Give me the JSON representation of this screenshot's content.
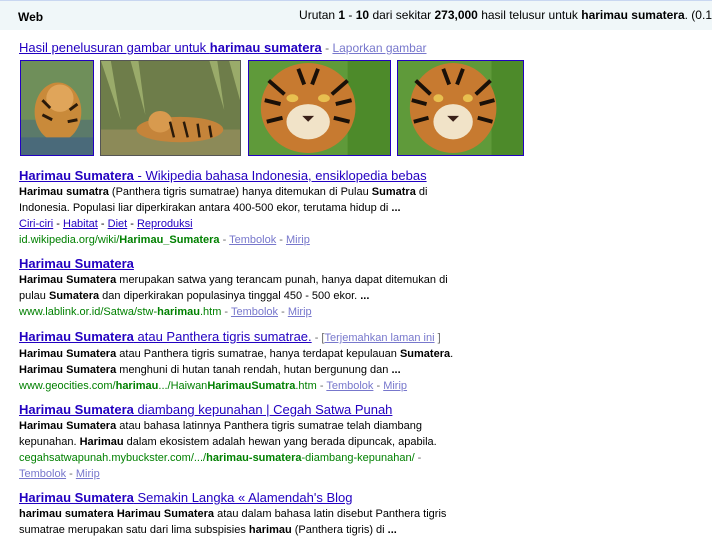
{
  "header": {
    "tab": "Web",
    "stats": {
      "prefix": "Urutan ",
      "from": "1",
      "dash": " - ",
      "to": "10",
      "mid": " dari sekitar ",
      "count": "273,000",
      "mid2": " hasil telusur untuk ",
      "query": "harimau sumatera",
      "suffix": ". (0.1"
    }
  },
  "images": {
    "link_prefix": "Hasil penelusuran gambar untuk ",
    "link_query": "harimau sumatera",
    "separator": " - ",
    "report": "Laporkan gambar",
    "thumbs": [
      {
        "icon": "tiger-in-water-image"
      },
      {
        "icon": "tiger-lying-image"
      },
      {
        "icon": "tiger-face-image"
      },
      {
        "icon": "tiger-face-image"
      }
    ]
  },
  "results": [
    {
      "title_a": "Harimau Sumatera",
      "title_b": " - Wikipedia bahasa Indonesia, ensiklopedia bebas",
      "snip_1a": "Harimau sumatra",
      "snip_1b": " (Panthera tigris sumatrae) hanya ditemukan di Pulau ",
      "snip_1c": "Sumatra",
      "snip_1d": " di",
      "snip_2": "Indonesia. Populasi liar diperkirakan antara 400-500 ekor, terutama hidup di ",
      "snip_2e": "...",
      "sublinks": [
        "Ciri-ciri",
        "Habitat",
        "Diet",
        "Reproduksi"
      ],
      "url_a": "id.wikipedia.org/wiki/",
      "url_b": "Harimau_Sumatera",
      "cache": "Tembolok",
      "similar": "Mirip"
    },
    {
      "title_a": "Harimau Sumatera",
      "snip_1a": "Harimau Sumatera",
      "snip_1b": " merupakan satwa yang terancam punah, hanya dapat ditemukan di",
      "snip_2a": "pulau ",
      "snip_2b": "Sumatera",
      "snip_2c": " dan diperkirakan populasinya tinggal 450 - 500 ekor. ",
      "snip_2e": "...",
      "url_a": "www.lablink.or.id/Satwa/stw-",
      "url_b": "harimau",
      "url_c": ".htm",
      "cache": "Tembolok",
      "similar": "Mirip"
    },
    {
      "title_a": "Harimau Sumatera",
      "title_b": " atau Panthera tigris sumatrae.",
      "translate_open": " - [",
      "translate": "Terjemahkan laman ini",
      "translate_close": " ]",
      "snip_1a": "Harimau Sumatera",
      "snip_1b": " atau Panthera tigris sumatrae, hanya terdapat kepulauan ",
      "snip_1c": "Sumatera",
      "snip_1d": ".",
      "snip_2a": "Harimau Sumatera",
      "snip_2b": " menghuni di hutan tanah rendah, hutan bergunung dan ",
      "snip_2e": "...",
      "url_a": "www.geocities.com/",
      "url_b": "harimau",
      "url_c": ".../Haiwan",
      "url_d": "HarimauSumatra",
      "url_e": ".htm",
      "cache": "Tembolok",
      "similar": "Mirip"
    },
    {
      "title_a": "Harimau Sumatera",
      "title_b": " diambang kepunahan | Cegah Satwa Punah",
      "snip_1a": "Harimau Sumatera",
      "snip_1b": " atau bahasa latinnya Panthera tigris sumatrae telah diambang",
      "snip_2a": "kepunahan. ",
      "snip_2b": "Harimau",
      "snip_2c": " dalam ekosistem adalah hewan yang berada dipuncak, apabila.",
      "url_a": "cegahsatwapunah.mybuckster.com/.../",
      "url_b": "harimau-sumatera",
      "url_c": "-diambang-kepunahan/",
      "cache": "Tembolok",
      "similar": "Mirip"
    },
    {
      "title_a": "Harimau Sumatera",
      "title_b": " Semakin Langka « Alamendah's Blog",
      "snip_1a": "harimau sumatera Harimau Sumatera",
      "snip_1b": " atau dalam bahasa latin disebut Panthera tigris",
      "snip_2a": "sumatrae merupakan satu dari lima subspisies ",
      "snip_2b": "harimau",
      "snip_2c": " (Panthera tigris) di ",
      "snip_2e": "..."
    }
  ],
  "colors": {
    "link": "#2200c1",
    "url_green": "#008000",
    "gray_link": "#7777cc",
    "topbar_bg": "#f0f7f9"
  }
}
